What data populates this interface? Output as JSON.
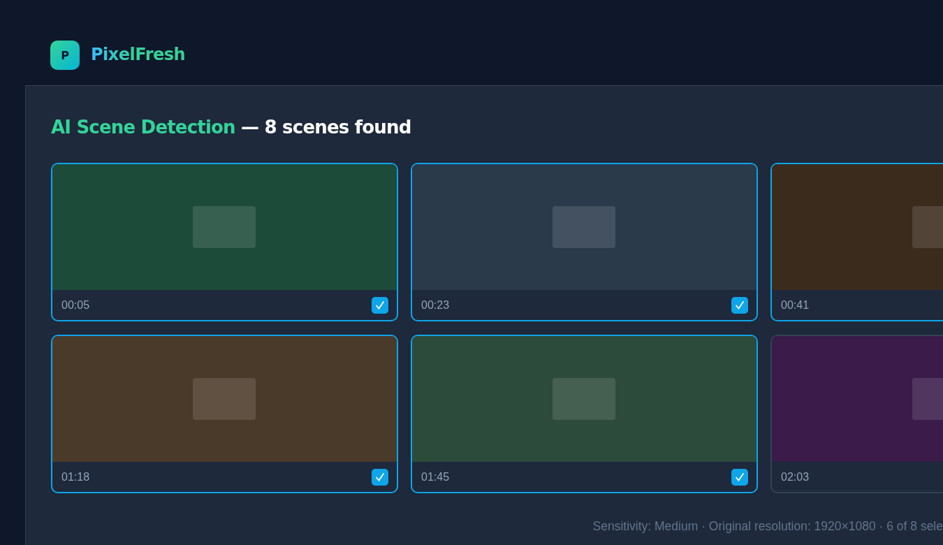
{
  "app": {
    "logo_letter": "P",
    "name": "PixelFresh"
  },
  "heading": {
    "title": "AI Scene Detection",
    "subtitle": "— 8 scenes found"
  },
  "scenes": [
    {
      "time": "00:05",
      "selected": true,
      "color": "#1c4b3a"
    },
    {
      "time": "00:23",
      "selected": true,
      "color": "#2b3a4b"
    },
    {
      "time": "00:41",
      "selected": true,
      "color": "#3b2b1c"
    },
    {
      "time": "01:18",
      "selected": true,
      "color": "#4a3a2a"
    },
    {
      "time": "01:45",
      "selected": true,
      "color": "#2c4b3a"
    },
    {
      "time": "02:03",
      "selected": false,
      "color": "#3a1b4a"
    }
  ],
  "footer": "Sensitivity: Medium · Original resolution: 1920×1080 · 6 of 8 sele"
}
